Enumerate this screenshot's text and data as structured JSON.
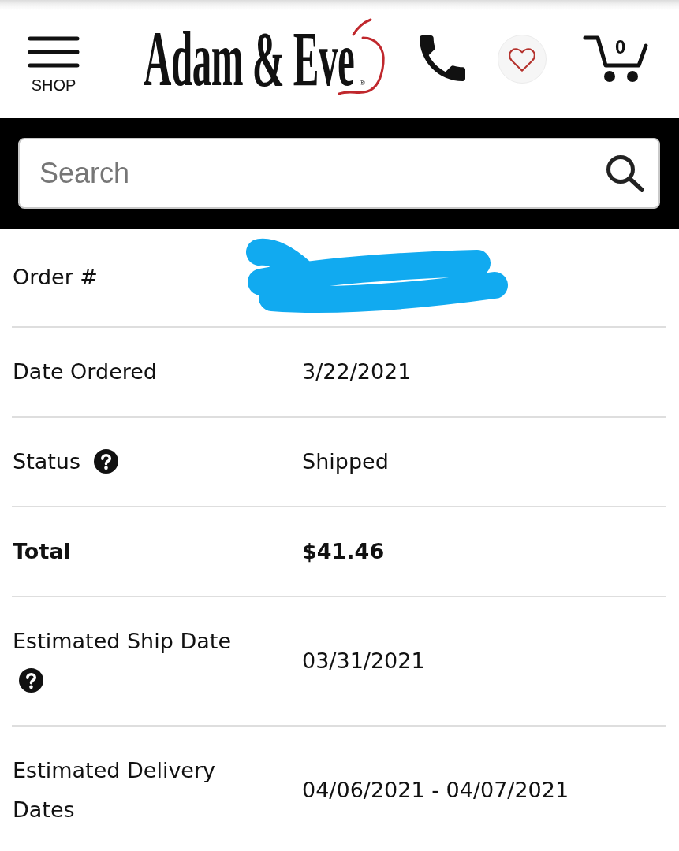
{
  "header": {
    "menu_label": "SHOP",
    "logo_text": "Adam & Eve",
    "logo_mark": "®",
    "cart_count": "0"
  },
  "search": {
    "placeholder": "Search"
  },
  "order_details": [
    {
      "label": "Order #",
      "help": false,
      "redacted": true,
      "emphasis": false
    },
    {
      "label": "Date Ordered",
      "value": "3/22/2021",
      "help": false,
      "redacted": false,
      "emphasis": false
    },
    {
      "label": "Status",
      "value": "Shipped",
      "help": true,
      "redacted": false,
      "emphasis": false
    },
    {
      "label": "Total",
      "value": "$41.46",
      "help": false,
      "redacted": false,
      "emphasis": true
    },
    {
      "label": "Estimated Ship Date",
      "value": "03/31/2021",
      "help": true,
      "redacted": false,
      "emphasis": false
    },
    {
      "label": "Estimated Delivery Dates",
      "value": "04/06/2021 - 04/07/2021",
      "help": false,
      "redacted": false,
      "emphasis": false
    }
  ]
}
